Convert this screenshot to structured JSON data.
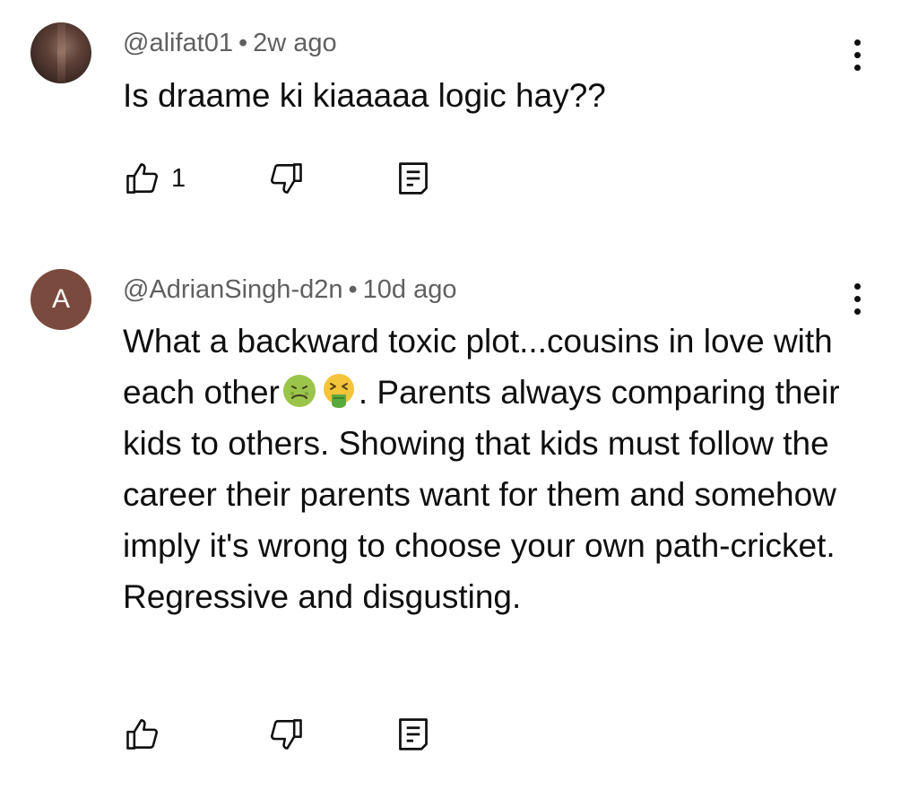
{
  "comments": [
    {
      "avatar": {
        "type": "photo",
        "icon": "user-photo-avatar"
      },
      "handle": "@alifat01",
      "separator": "•",
      "time": "2w ago",
      "text": "Is draame ki kiaaaaa logic hay??",
      "likes": "1"
    },
    {
      "avatar": {
        "type": "letter",
        "letter": "A",
        "color": "#7b4a3e"
      },
      "handle": "@AdrianSingh-d2n",
      "separator": "•",
      "time": "10d ago",
      "text_before_emoji": "What a backward toxic plot...cousins in love with each other",
      "emojis": [
        "nauseated-face-emoji",
        "face-vomiting-emoji"
      ],
      "text_after_emoji": ". Parents always comparing their kids to others. Showing that kids must follow the career their parents want for them and somehow imply it's wrong to choose your own path-cricket. Regressive and disgusting.",
      "likes": ""
    }
  ],
  "icons": {
    "like": "thumbs-up-icon",
    "dislike": "thumbs-down-icon",
    "reply": "reply-icon",
    "more": "more-vertical-icon"
  },
  "colors": {
    "text": "#0f0f0f",
    "meta": "#606060",
    "background": "#ffffff"
  }
}
